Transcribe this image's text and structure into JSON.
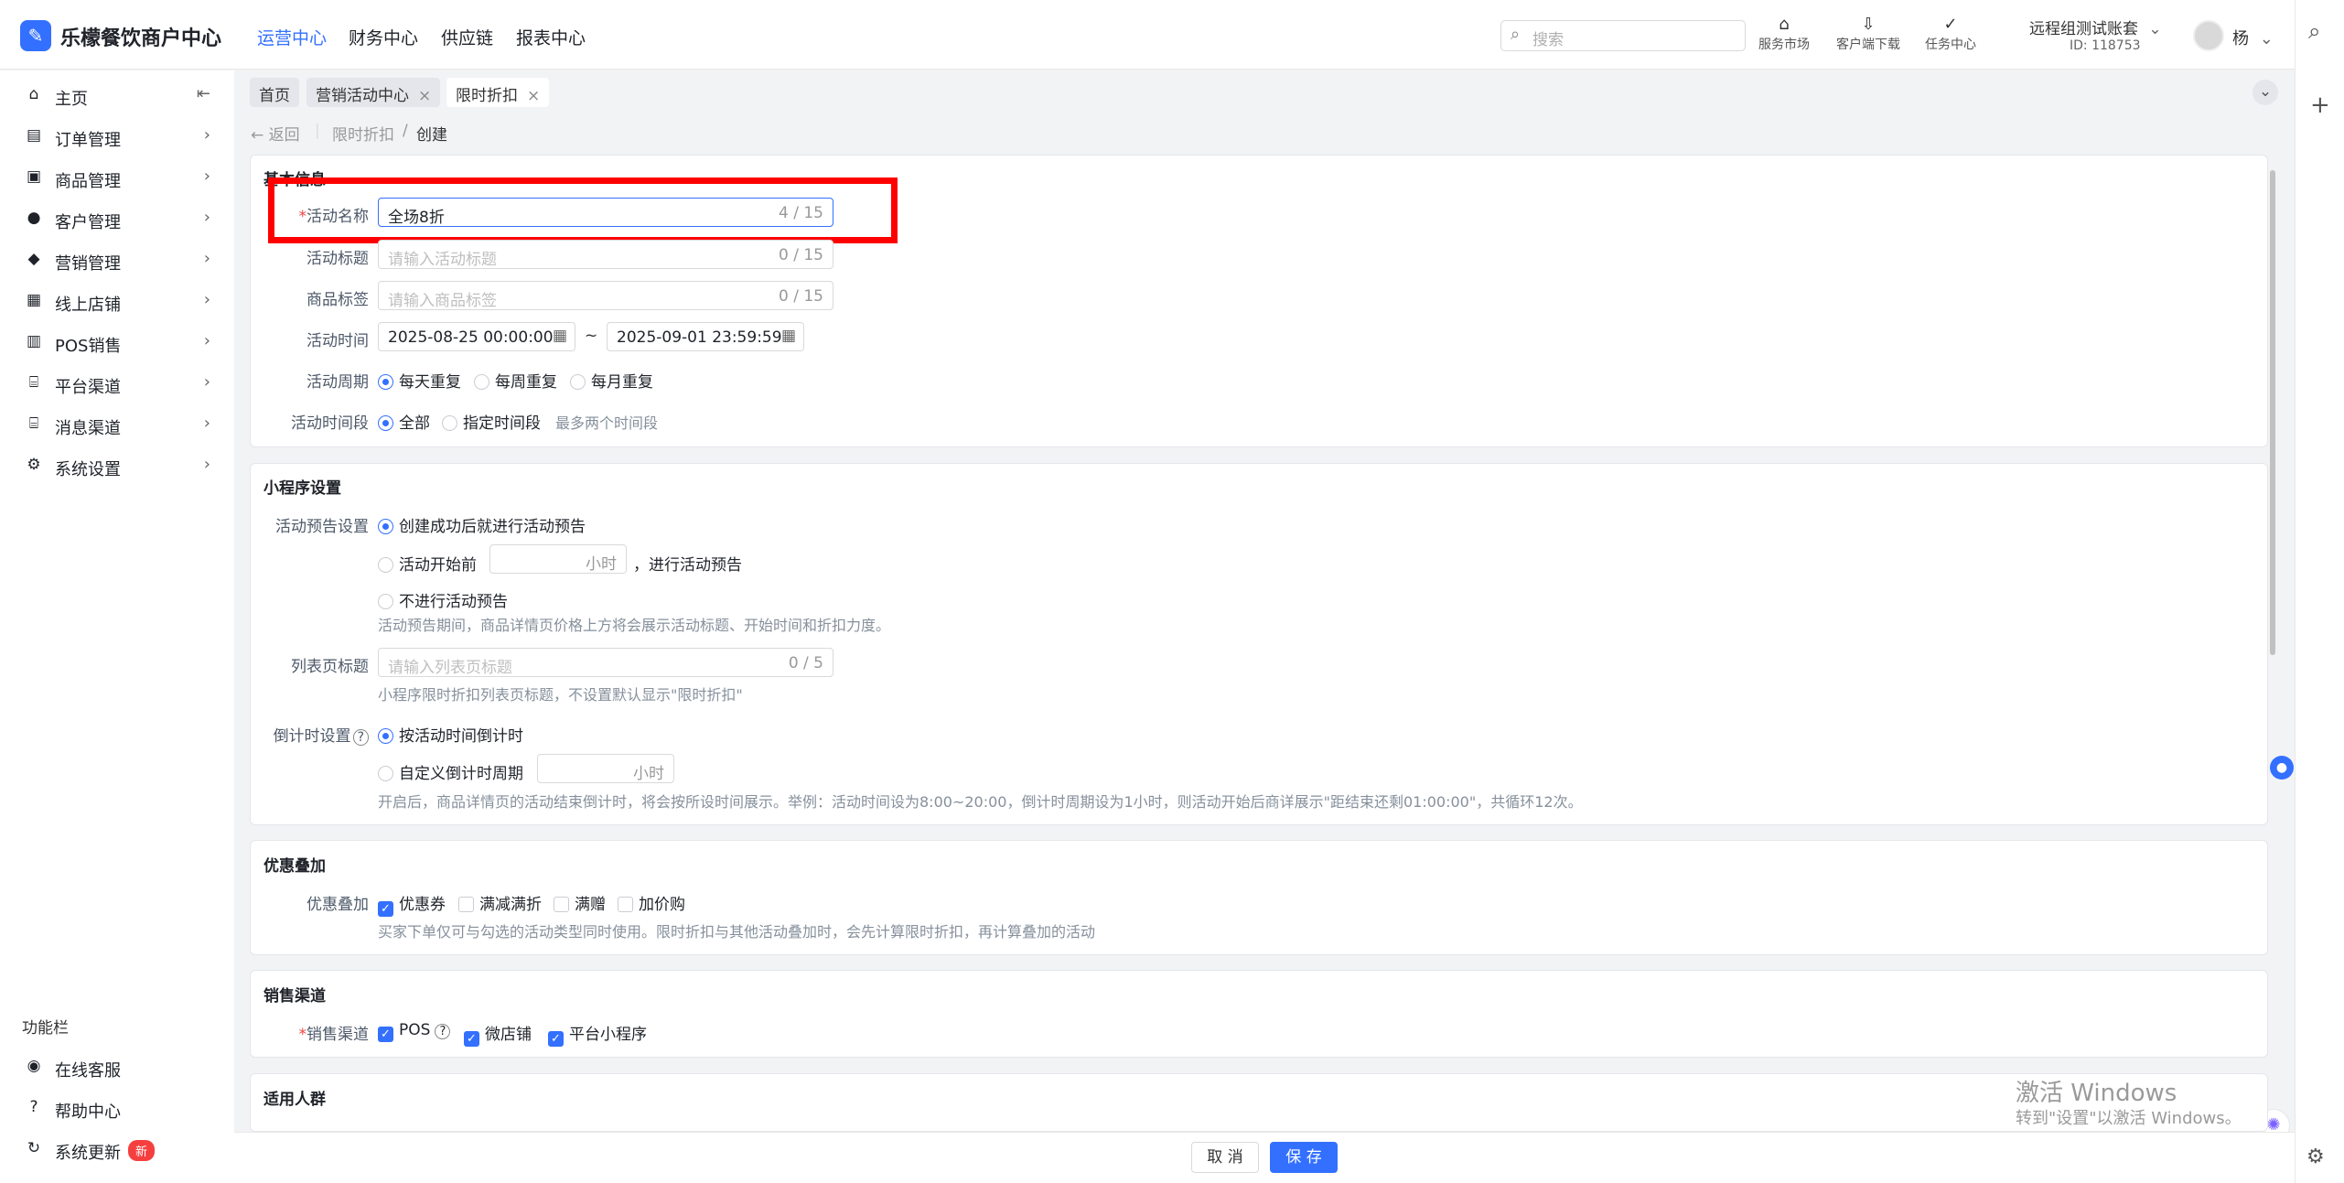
{
  "header": {
    "logo_glyph": "✎",
    "app_name": "乐檬餐饮商户中心",
    "nav": [
      "运营中心",
      "财务中心",
      "供应链",
      "报表中心"
    ],
    "search_placeholder": "搜索",
    "tools": [
      {
        "label": "服务市场",
        "icon": "market-icon"
      },
      {
        "label": "客户端下载",
        "icon": "download-folder-icon"
      },
      {
        "label": "任务中心",
        "icon": "task-icon"
      }
    ],
    "account_name": "远程组测试账套",
    "account_id": "ID: 118753",
    "user": "杨"
  },
  "sidebar": {
    "items": [
      {
        "label": "主页",
        "icon": "home-icon"
      },
      {
        "label": "订单管理",
        "icon": "order-icon"
      },
      {
        "label": "商品管理",
        "icon": "product-icon"
      },
      {
        "label": "客户管理",
        "icon": "customer-icon"
      },
      {
        "label": "营销管理",
        "icon": "marketing-icon"
      },
      {
        "label": "线上店铺",
        "icon": "store-icon"
      },
      {
        "label": "POS销售",
        "icon": "pos-icon"
      },
      {
        "label": "平台渠道",
        "icon": "platform-icon"
      },
      {
        "label": "消息渠道",
        "icon": "message-icon"
      },
      {
        "label": "系统设置",
        "icon": "settings-icon"
      }
    ],
    "footer_title": "功能栏",
    "footer_items": [
      {
        "label": "在线客服"
      },
      {
        "label": "帮助中心"
      },
      {
        "label": "系统更新",
        "badge": "新"
      }
    ]
  },
  "tabs": [
    {
      "label": "首页"
    },
    {
      "label": "营销活动中心"
    },
    {
      "label": "限时折扣"
    }
  ],
  "breadcrumb": {
    "back": "返回",
    "parent": "限时折扣",
    "sep": "/",
    "current": "创建"
  },
  "basic": {
    "title": "基本信息",
    "name_label": "活动名称",
    "name_value": "全场8折",
    "name_count": "4 / 15",
    "title_label": "活动标题",
    "title_placeholder": "请输入活动标题",
    "title_count": "0 / 15",
    "tag_label": "商品标签",
    "tag_placeholder": "请输入商品标签",
    "tag_count": "0 / 15",
    "time_label": "活动时间",
    "time_start": "2025-08-25 00:00:00",
    "time_sep": "~",
    "time_end": "2025-09-01 23:59:59",
    "cycle_label": "活动周期",
    "cycle_options": [
      "每天重复",
      "每周重复",
      "每月重复"
    ],
    "period_label": "活动时间段",
    "period_options": [
      "全部",
      "指定时间段"
    ],
    "period_hint": "最多两个时间段"
  },
  "mini": {
    "title": "小程序设置",
    "preview_label": "活动预告设置",
    "preview_opt1": "创建成功后就进行活动预告",
    "preview_opt2": "活动开始前",
    "preview_hours_unit": "小时",
    "preview_opt2_suffix": "，进行活动预告",
    "preview_opt3": "不进行活动预告",
    "preview_hint": "活动预告期间，商品详情页价格上方将会展示活动标题、开始时间和折扣力度。",
    "list_title_label": "列表页标题",
    "list_title_placeholder": "请输入列表页标题",
    "list_title_count": "0 / 5",
    "list_title_hint": "小程序限时折扣列表页标题，不设置默认显示\"限时折扣\"",
    "countdown_label": "倒计时设置",
    "countdown_opt1": "按活动时间倒计时",
    "countdown_opt2": "自定义倒计时周期",
    "countdown_unit": "小时",
    "countdown_hint": "开启后，商品详情页的活动结束倒计时，将会按所设时间展示。举例：活动时间设为8:00~20:00，倒计时周期设为1小时，则活动开始后商详展示\"距结束还剩01:00:00\"，共循环12次。"
  },
  "stack": {
    "title": "优惠叠加",
    "label": "优惠叠加",
    "options": [
      {
        "label": "优惠券",
        "checked": true
      },
      {
        "label": "满减满折",
        "checked": false
      },
      {
        "label": "满赠",
        "checked": false
      },
      {
        "label": "加价购",
        "checked": false
      }
    ],
    "hint": "买家下单仅可与勾选的活动类型同时使用。限时折扣与其他活动叠加时，会先计算限时折扣，再计算叠加的活动"
  },
  "channel": {
    "title": "销售渠道",
    "label": "销售渠道",
    "options": [
      {
        "label": "POS",
        "checked": true
      },
      {
        "label": "微店铺",
        "checked": true
      },
      {
        "label": "平台小程序",
        "checked": true
      }
    ]
  },
  "audience": {
    "title": "适用人群"
  },
  "footer": {
    "cancel": "取 消",
    "save": "保 存"
  },
  "watermark": {
    "line1": "激活 Windows",
    "line2": "转到\"设置\"以激活 Windows。"
  },
  "colors": {
    "primary": "#3370ff",
    "highlight": "#ff0000",
    "required": "#f53f3f"
  }
}
